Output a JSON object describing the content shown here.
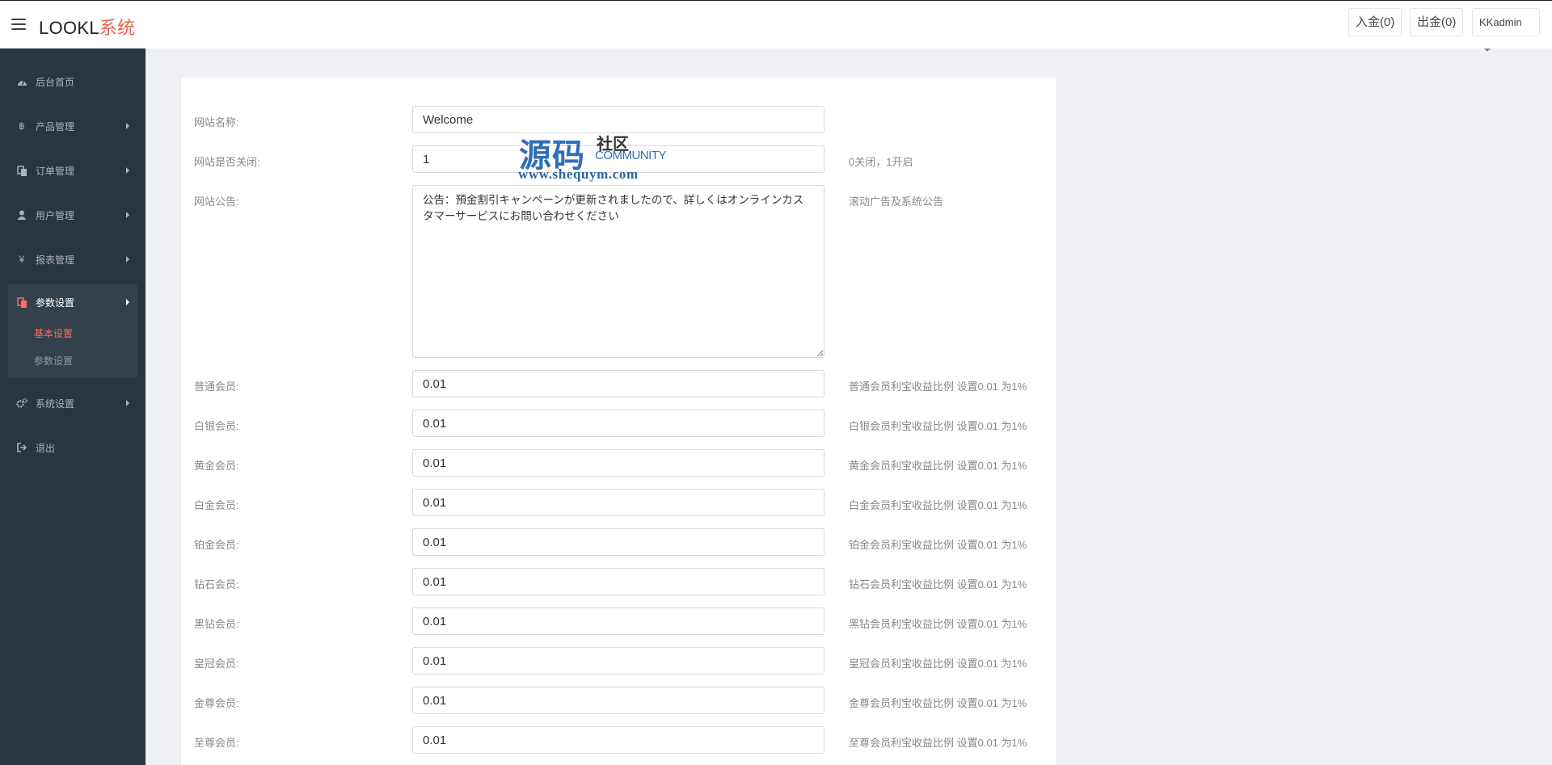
{
  "header": {
    "brand_main": "LOOKL",
    "brand_accent": "系统",
    "deposit_label": "入金(0)",
    "withdraw_label": "出金(0)",
    "user_label": "KKadmin"
  },
  "sidebar": {
    "items": [
      {
        "label": "后台首页",
        "icon": "dashboard-icon"
      },
      {
        "label": "产品管理",
        "icon": "bitcoin-icon"
      },
      {
        "label": "订单管理",
        "icon": "copy-icon"
      },
      {
        "label": "用户管理",
        "icon": "user-icon"
      },
      {
        "label": "报表管理",
        "icon": "yen-icon"
      },
      {
        "label": "参数设置",
        "icon": "copy-icon"
      },
      {
        "label": "系统设置",
        "icon": "gears-icon"
      },
      {
        "label": "退出",
        "icon": "sign-out-icon"
      }
    ],
    "sub_items": [
      {
        "label": "基本设置",
        "active": true
      },
      {
        "label": "参数设置",
        "active": false
      }
    ],
    "active_color": "#ff6c60"
  },
  "form": {
    "site_name": {
      "label": "网站名称:",
      "value": "Welcome"
    },
    "site_closed": {
      "label": "网站是否关闭:",
      "value": "1",
      "help": "0关闭，1开启"
    },
    "announcement": {
      "label": "网站公告:",
      "value": "公告：預金割引キャンペーンが更新されましたので、詳しくはオンラインカスタマーサービスにお問い合わせください",
      "help": "滚动广告及系统公告"
    },
    "members": [
      {
        "label": "普通会员:",
        "value": "0.01",
        "help": "普通会员利宝收益比例 设置0.01 为1%"
      },
      {
        "label": "白银会员:",
        "value": "0.01",
        "help": "白银会员利宝收益比例 设置0.01 为1%"
      },
      {
        "label": "黄金会员:",
        "value": "0.01",
        "help": "黄金会员利宝收益比例 设置0.01 为1%"
      },
      {
        "label": "白金会员:",
        "value": "0.01",
        "help": "白金会员利宝收益比例 设置0.01 为1%"
      },
      {
        "label": "铂金会员:",
        "value": "0.01",
        "help": "铂金会员利宝收益比例 设置0.01 为1%"
      },
      {
        "label": "钻石会员:",
        "value": "0.01",
        "help": "钻石会员利宝收益比例 设置0.01 为1%"
      },
      {
        "label": "黑钻会员:",
        "value": "0.01",
        "help": "黑钻会员利宝收益比例 设置0.01 为1%"
      },
      {
        "label": "皇冠会员:",
        "value": "0.01",
        "help": "皇冠会员利宝收益比例 设置0.01 为1%"
      },
      {
        "label": "金尊会员:",
        "value": "0.01",
        "help": "金尊会员利宝收益比例 设置0.01 为1%"
      },
      {
        "label": "至尊会员:",
        "value": "0.01",
        "help": "至尊会员利宝收益比例 设置0.01 为1%"
      }
    ]
  },
  "watermark": {
    "big": "源码",
    "small1": "社区",
    "small2": "COMMUNITY",
    "url": "www.shequym.com"
  }
}
